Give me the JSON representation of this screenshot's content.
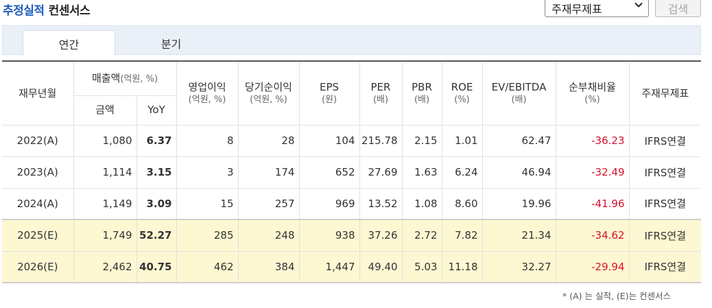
{
  "header": {
    "title_highlight": "추정실적",
    "title_rest": "컨센서스",
    "select_value": "주재무제표",
    "search_label": "검색"
  },
  "tabs": [
    {
      "label": "연간",
      "active": true
    },
    {
      "label": "분기",
      "active": false
    }
  ],
  "table": {
    "headers": {
      "year": "재무년월",
      "sales": "매출액",
      "sales_unit": "(억원, %)",
      "sales_amount": "금액",
      "sales_yoy": "YoY",
      "op": "영업이익",
      "op_unit": "(억원, %)",
      "net": "당기순이익",
      "net_unit": "(억원, %)",
      "eps": "EPS",
      "eps_unit": "(원)",
      "per": "PER",
      "per_unit": "(배)",
      "pbr": "PBR",
      "pbr_unit": "(배)",
      "roe": "ROE",
      "roe_unit": "(%)",
      "ev": "EV/EBITDA",
      "ev_unit": "(배)",
      "debt": "순부채비율",
      "debt_unit": "(%)",
      "fs": "주재무제표"
    },
    "rows": [
      {
        "year": "2022(A)",
        "amount": "1,080",
        "yoy": "6.37",
        "op": "8",
        "net": "28",
        "eps": "104",
        "per": "215.78",
        "pbr": "2.15",
        "roe": "1.01",
        "ev": "62.47",
        "debt": "-36.23",
        "fs": "IFRS연결"
      },
      {
        "year": "2023(A)",
        "amount": "1,114",
        "yoy": "3.15",
        "op": "3",
        "net": "174",
        "eps": "652",
        "per": "27.69",
        "pbr": "1.63",
        "roe": "6.24",
        "ev": "46.94",
        "debt": "-32.49",
        "fs": "IFRS연결"
      },
      {
        "year": "2024(A)",
        "amount": "1,149",
        "yoy": "3.09",
        "op": "15",
        "net": "257",
        "eps": "969",
        "per": "13.52",
        "pbr": "1.08",
        "roe": "8.60",
        "ev": "19.96",
        "debt": "-41.96",
        "fs": "IFRS연결"
      },
      {
        "year": "2025(E)",
        "amount": "1,749",
        "yoy": "52.27",
        "op": "285",
        "net": "248",
        "eps": "938",
        "per": "37.26",
        "pbr": "2.72",
        "roe": "7.82",
        "ev": "21.34",
        "debt": "-34.62",
        "fs": "IFRS연결"
      },
      {
        "year": "2026(E)",
        "amount": "2,462",
        "yoy": "40.75",
        "op": "462",
        "net": "384",
        "eps": "1,447",
        "per": "49.40",
        "pbr": "5.03",
        "roe": "11.18",
        "ev": "32.27",
        "debt": "-29.94",
        "fs": "IFRS연결"
      }
    ]
  },
  "footnote": "* (A) 는 실적, (E)는 컨센서스",
  "colors": {
    "title_accent": "#1e5bbd",
    "negative": "#d8122c",
    "estimate_row_bg": "#fdf7d2",
    "tab_bar_bg": "#eaf0f7"
  }
}
